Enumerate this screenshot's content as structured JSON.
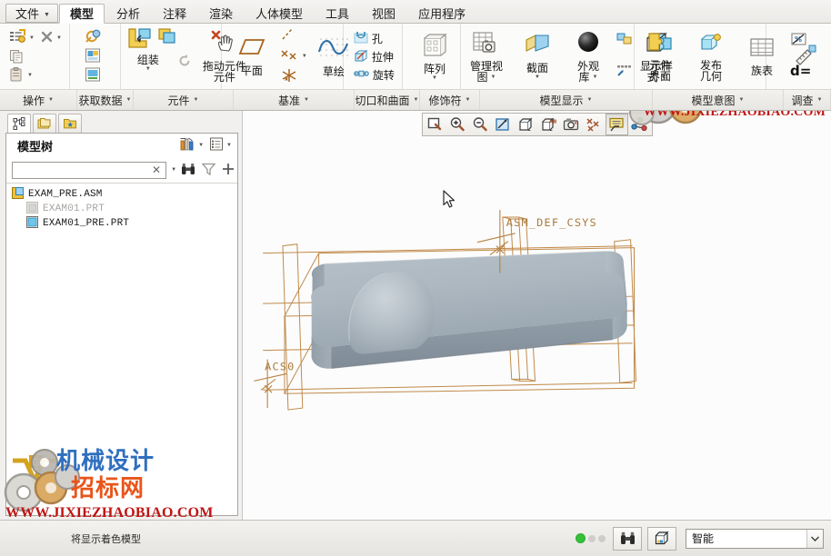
{
  "menu": {
    "file_label": "文件",
    "tabs": [
      {
        "label": "模型",
        "active": true
      },
      {
        "label": "分析",
        "active": false
      },
      {
        "label": "注释",
        "active": false
      },
      {
        "label": "渲染",
        "active": false
      },
      {
        "label": "人体模型",
        "active": false
      },
      {
        "label": "工具",
        "active": false
      },
      {
        "label": "视图",
        "active": false
      },
      {
        "label": "应用程序",
        "active": false
      }
    ]
  },
  "ribbon": {
    "groups": [
      {
        "name": "操作",
        "label": "操作",
        "items": [
          {
            "label": "重新生成",
            "icon": "regenerate-icon"
          },
          {
            "label": "删除",
            "icon": "delete-x-icon"
          },
          {
            "label": "复制",
            "icon": "copy-icon"
          },
          {
            "label": "粘贴",
            "icon": "paste-icon"
          }
        ]
      },
      {
        "name": "获取数据",
        "label": "获取数据",
        "items": [
          {
            "label": "用户定义特征",
            "icon": "udf-icon"
          },
          {
            "label": "合并继承",
            "icon": "merge-icon"
          },
          {
            "label": "收缩包络",
            "icon": "shrinkwrap-icon"
          }
        ]
      },
      {
        "name": "元件",
        "label": "元件",
        "items": [
          {
            "label": "组装",
            "icon": "assemble-icon"
          },
          {
            "label": "创建",
            "icon": "create-component-icon"
          },
          {
            "label": "重复",
            "icon": "repeat-icon"
          },
          {
            "label": "拖动元件",
            "label2": "元件",
            "icon": "drag-component-icon"
          }
        ]
      },
      {
        "name": "基准",
        "label": "基准",
        "items": [
          {
            "label": "平面",
            "icon": "datum-plane-icon"
          },
          {
            "label": "轴",
            "icon": "datum-axis-icon"
          },
          {
            "label": "点",
            "icon": "datum-point-icon"
          },
          {
            "label": "坐标系",
            "icon": "datum-csys-icon"
          },
          {
            "label": "草绘",
            "icon": "sketch-icon"
          }
        ]
      },
      {
        "name": "切口和曲面",
        "label": "切口和曲面",
        "items": [
          {
            "label": "孔",
            "icon": "hole-icon"
          },
          {
            "label": "拉伸",
            "icon": "extrude-icon"
          },
          {
            "label": "旋转",
            "icon": "revolve-icon"
          }
        ]
      },
      {
        "name": "修饰符",
        "label": "修饰符",
        "items": [
          {
            "label": "阵列",
            "icon": "pattern-icon"
          }
        ]
      },
      {
        "name": "模型显示",
        "label": "模型显示",
        "items": [
          {
            "label": "管理视",
            "label2": "图",
            "icon": "manage-views-icon"
          },
          {
            "label": "截面",
            "icon": "section-icon"
          },
          {
            "label": "外观",
            "label2": "库",
            "icon": "appearance-icon"
          },
          {
            "label": "显示样",
            "label2": "式",
            "icon": "display-style-icon"
          },
          {
            "label": "透视图",
            "icon": "perspective-icon"
          },
          {
            "label": "层",
            "icon": "layer-icon"
          }
        ]
      },
      {
        "name": "模型意图",
        "label": "模型意图",
        "items": [
          {
            "label": "元件",
            "label2": "界面",
            "icon": "component-interface-icon"
          },
          {
            "label": "发布",
            "label2": "几何",
            "icon": "publish-geometry-icon"
          },
          {
            "label": "族表",
            "icon": "family-table-icon"
          },
          {
            "label": "参数",
            "icon": "parameters-d-icon"
          },
          {
            "label": "关系",
            "icon": "relations-icon"
          }
        ]
      },
      {
        "name": "调查",
        "label": "调查",
        "items": [
          {
            "label": "测量",
            "icon": "measure-icon"
          }
        ]
      }
    ]
  },
  "left_panel": {
    "nav_tabs": [
      {
        "name": "model-tree",
        "icon": "tree-hierarchy-icon",
        "active": true
      },
      {
        "name": "folder-browser",
        "icon": "folder-stack-icon",
        "active": false
      },
      {
        "name": "favorites",
        "icon": "folder-star-icon",
        "active": false
      }
    ],
    "tree_title": "模型树",
    "settings_icon": "tree-settings-icon",
    "display_icon": "tree-display-icon",
    "search": {
      "value": "",
      "placeholder": ""
    },
    "search_icons": [
      "find-binoculars-icon",
      "filter-funnel-icon",
      "add-plus-icon"
    ],
    "tree_items": [
      {
        "label": "EXAM_PRE.ASM",
        "icon": "assembly-icon",
        "level": 0,
        "dim": false
      },
      {
        "label": "EXAM01.PRT",
        "icon": "part-grey-icon",
        "level": 1,
        "dim": true
      },
      {
        "label": "EXAM01_PRE.PRT",
        "icon": "part-blue-icon",
        "level": 1,
        "dim": false
      }
    ]
  },
  "graphics_toolbar": {
    "buttons": [
      {
        "name": "refit-button",
        "icon": "refit-magnifier-icon",
        "pressed": false
      },
      {
        "name": "zoom-in-button",
        "icon": "zoom-in-icon",
        "pressed": false
      },
      {
        "name": "zoom-out-button",
        "icon": "zoom-out-icon",
        "pressed": false
      },
      {
        "name": "repaint-button",
        "icon": "repaint-icon",
        "pressed": false
      },
      {
        "name": "display-style-button",
        "icon": "shaded-cube-icon",
        "pressed": false
      },
      {
        "name": "saved-orientations-button",
        "icon": "named-view-icon",
        "pressed": false
      },
      {
        "name": "snapshot-button",
        "icon": "camera-icon",
        "pressed": false
      },
      {
        "name": "datum-display-button",
        "icon": "datum-display-icon",
        "pressed": false
      },
      {
        "name": "annotation-display-button",
        "icon": "annotation-display-icon",
        "pressed": true
      },
      {
        "name": "spin-center-button",
        "icon": "spin-center-icon",
        "pressed": false
      }
    ]
  },
  "model": {
    "csys_label": "ASM_DEF_CSYS",
    "acs_label": "ACS0",
    "surface_color": "#aab4bd",
    "datum_color": "#c08a4a"
  },
  "statusbar": {
    "message": "将显示着色模型",
    "selection_mode": "智能",
    "find_icon": "find-binoculars-icon",
    "view_icon": "shaded-cube-icon",
    "status_dots": [
      true,
      false,
      false
    ]
  },
  "watermarks": {
    "brand_cn": "机械设计",
    "brand_cn2": "招标网",
    "url": "WWW.JIXIEZHAOBIAO.COM",
    "logo_mark": "JG",
    "brand_color_blue": "#2f6fbf",
    "brand_color_orange": "#e8551b",
    "url_color": "#c01414"
  }
}
